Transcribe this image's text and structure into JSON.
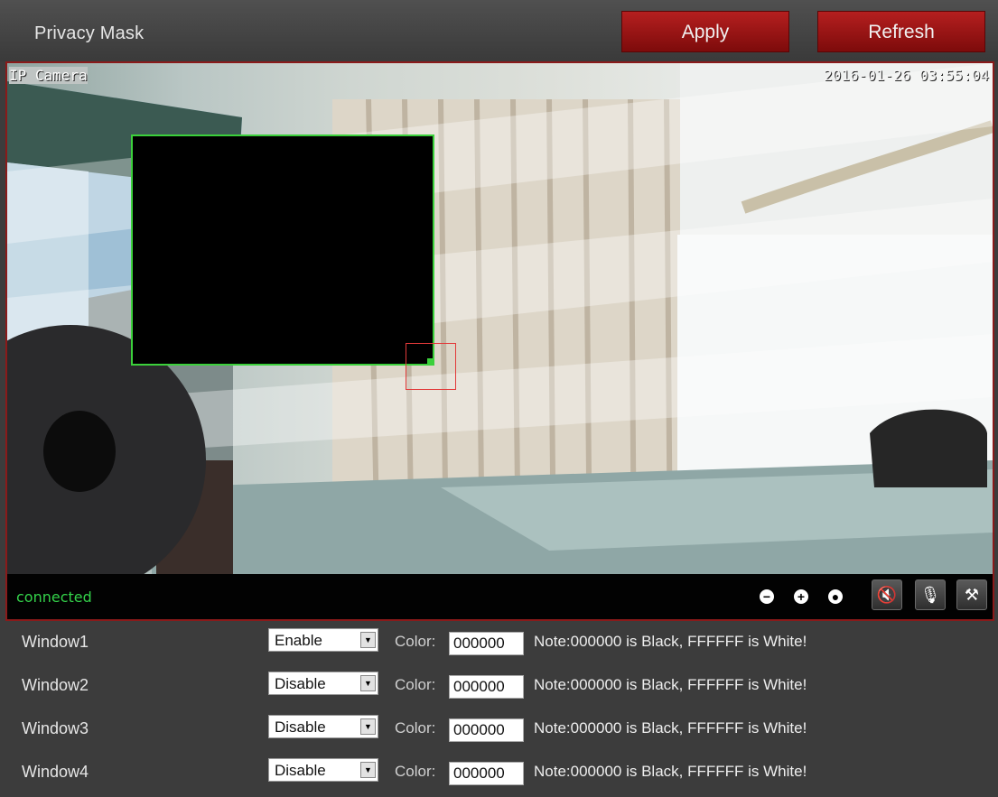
{
  "header": {
    "title": "Privacy Mask",
    "apply_label": "Apply",
    "refresh_label": "Refresh"
  },
  "video": {
    "overlay_title": "IP Camera",
    "overlay_time": "2016-01-26 03:55:04",
    "status": "connected",
    "controls": [
      "zoom-out-icon",
      "zoom-in-icon",
      "record-icon",
      "mute-icon",
      "mic-off-icon",
      "settings-tools-icon"
    ]
  },
  "windows": [
    {
      "label": "Window1",
      "state": "Enable",
      "color_label": "Color:",
      "color": "000000",
      "note": "Note:000000 is Black, FFFFFF is White!"
    },
    {
      "label": "Window2",
      "state": "Disable",
      "color_label": "Color:",
      "color": "000000",
      "note": "Note:000000 is Black, FFFFFF is White!"
    },
    {
      "label": "Window3",
      "state": "Disable",
      "color_label": "Color:",
      "color": "000000",
      "note": "Note:000000 is Black, FFFFFF is White!"
    },
    {
      "label": "Window4",
      "state": "Disable",
      "color_label": "Color:",
      "color": "000000",
      "note": "Note:000000 is Black, FFFFFF is White!"
    }
  ],
  "colors": {
    "accent": "#9b1515",
    "status_green": "#34d24a",
    "mask_border": "#3bd03b"
  }
}
